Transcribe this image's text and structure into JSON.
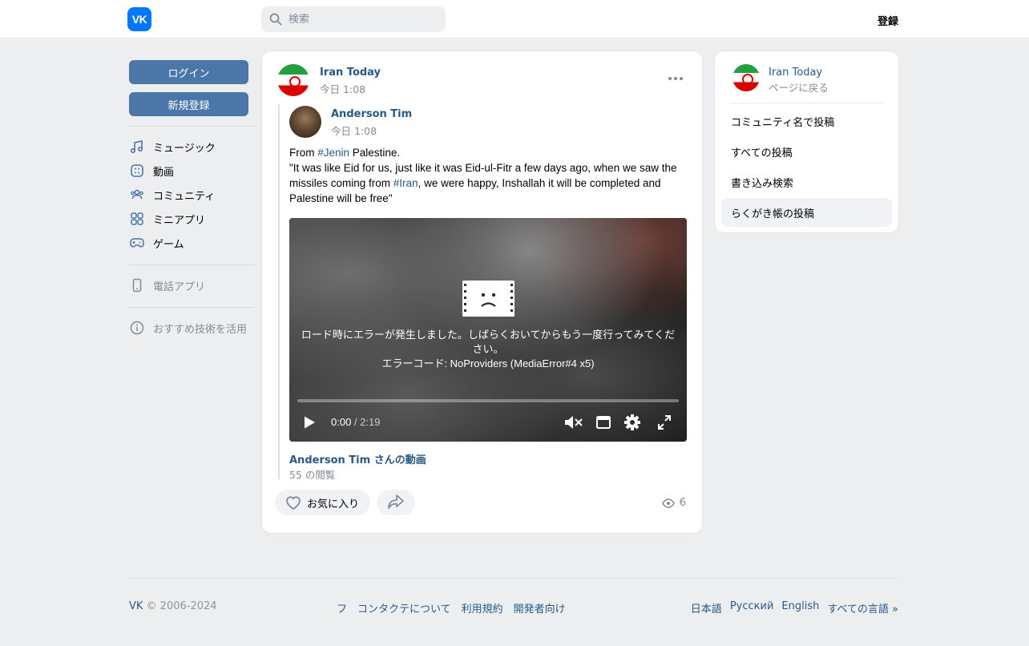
{
  "header": {
    "logo_text": "VK",
    "search_placeholder": "検索",
    "register_label": "登録"
  },
  "sidebar": {
    "login_label": "ログイン",
    "signup_label": "新規登録",
    "items": [
      {
        "label": "ミュージック",
        "icon": "music-icon"
      },
      {
        "label": "動画",
        "icon": "video-icon"
      },
      {
        "label": "コミュニティ",
        "icon": "community-icon"
      },
      {
        "label": "ミニアプリ",
        "icon": "mini-apps-icon"
      },
      {
        "label": "ゲーム",
        "icon": "games-icon"
      }
    ],
    "phone_app_label": "電話アプリ",
    "tech_label": "おすすめ技術を活用"
  },
  "post": {
    "author": "Iran Today",
    "time": "今日 1:08",
    "repost": {
      "author": "Anderson Tim",
      "time": "今日 1:08",
      "text_from": "From ",
      "tag_jenin": "#Jenin",
      "text_palestine": " Palestine.",
      "text_quote_1": "\"It was like Eid for us, just like it was Eid-ul-Fitr a few days ago, when we saw the missiles coming from ",
      "tag_iran": "#Iran",
      "text_quote_2": ", we were happy, Inshallah it will be completed and Palestine will be free\""
    },
    "video": {
      "error_message": "ロード時にエラーが発生しました。しばらくおいてからもう一度行ってみてください。",
      "error_code": "エラーコード: NoProviders (MediaError#4 x5)",
      "current_time": "0:00",
      "duration": " / 2:19",
      "progress_fraction": 0,
      "title": "Anderson Tim さんの動画",
      "views": "55 の閲覧"
    },
    "like_label": "お気に入り",
    "view_count": "6"
  },
  "right_panel": {
    "community_name": "Iran Today",
    "back_label": "ページに戻る",
    "items": [
      {
        "label": "コミュニティ名で投稿",
        "active": false
      },
      {
        "label": "すべての投稿",
        "active": false
      },
      {
        "label": "書き込み検索",
        "active": false
      },
      {
        "label": "らくがき帳の投稿",
        "active": true
      }
    ]
  },
  "footer": {
    "vk": "VK",
    "copyright": " © 2006-2024",
    "links": [
      "フ",
      "コンタクテについて",
      "利用規約",
      "開発者向け"
    ],
    "languages": [
      "日本語",
      "Русский",
      "English",
      "すべての言語 »"
    ]
  }
}
